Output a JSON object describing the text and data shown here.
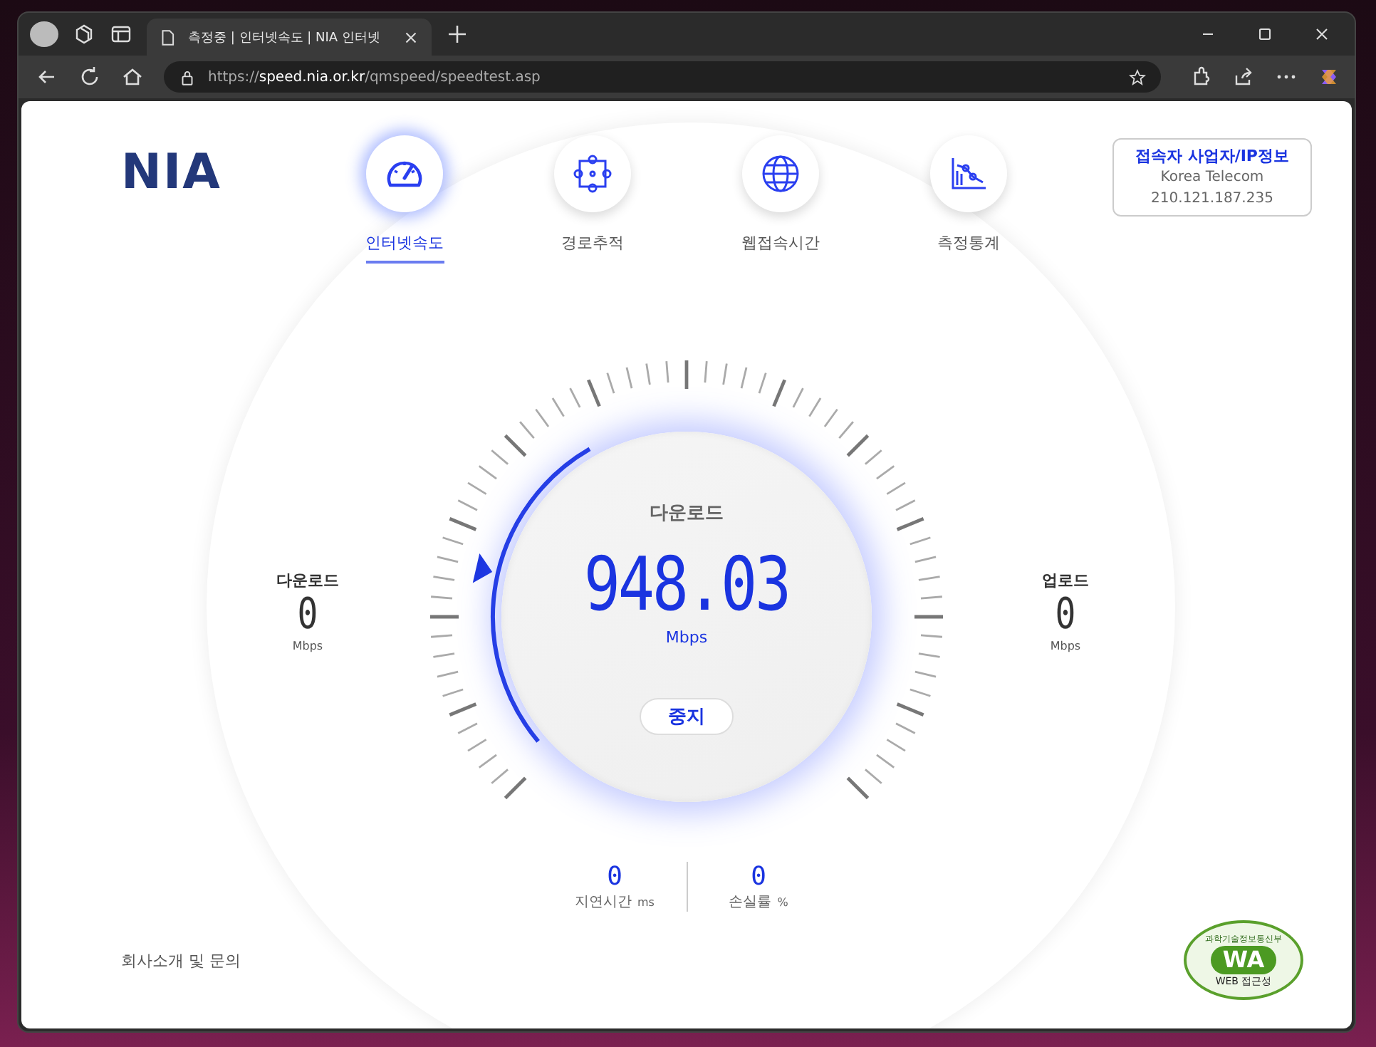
{
  "browser": {
    "tab_title": "측정중 | 인터넷속도 | NIA 인터넷",
    "url_scheme": "https://",
    "url_host": "speed.nia.or.kr",
    "url_path": "/qmspeed/speedtest.asp"
  },
  "logo": "NIA",
  "nav": [
    {
      "label": "인터넷속도",
      "selected": true,
      "kind": "gauge"
    },
    {
      "label": "경로추적",
      "selected": false,
      "kind": "route"
    },
    {
      "label": "웹접속시간",
      "selected": false,
      "kind": "globe"
    },
    {
      "label": "측정통계",
      "selected": false,
      "kind": "stats"
    }
  ],
  "provider_info": {
    "title": "접속자 사업자/IP정보",
    "isp": "Korea Telecom",
    "ip": "210.121.187.235"
  },
  "gauge": {
    "label": "다운로드",
    "value": "948.03",
    "unit": "Mbps",
    "stop_button": "중지"
  },
  "side_stats": [
    {
      "label": "다운로드",
      "value": "0",
      "unit": "Mbps"
    },
    {
      "label": "업로드",
      "value": "0",
      "unit": "Mbps"
    }
  ],
  "bottom_stats": [
    {
      "label": "지연시간",
      "value": "0",
      "unit": "ms"
    },
    {
      "label": "손실률",
      "value": "0",
      "unit": "%"
    }
  ],
  "footer_link": "회사소개 및 문의",
  "badge": {
    "top": "과학기술정보통신부",
    "mark": "WA",
    "bottom": "WEB 접근성"
  }
}
